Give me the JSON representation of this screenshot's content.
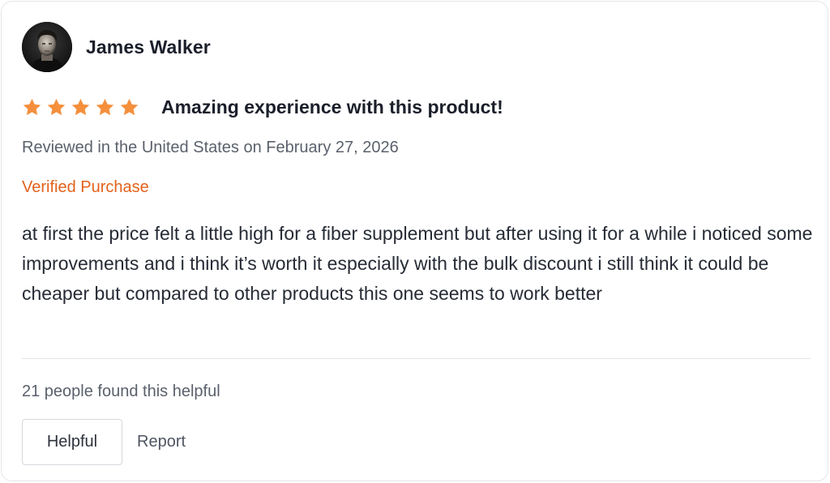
{
  "review": {
    "reviewer": {
      "name": "James Walker",
      "avatar": "portrait-photo"
    },
    "rating": {
      "value": 5,
      "max": 5,
      "star_color": "#f58f3c",
      "icon": "star-icon"
    },
    "title": "Amazing experience with this product!",
    "date_line": "Reviewed in the United States on February 27, 2026",
    "verified_label": "Verified Purchase",
    "verified_color": "#e2621b",
    "body": "at first the price felt a little high for a fiber supplement but after using it for a while i noticed some improvements and i think it’s worth it especially with the bulk discount i still think it could be cheaper but compared to other products this one seems to work better",
    "helpful_count_text": "21 people found this helpful",
    "actions": {
      "helpful_label": "Helpful",
      "report_label": "Report"
    }
  }
}
